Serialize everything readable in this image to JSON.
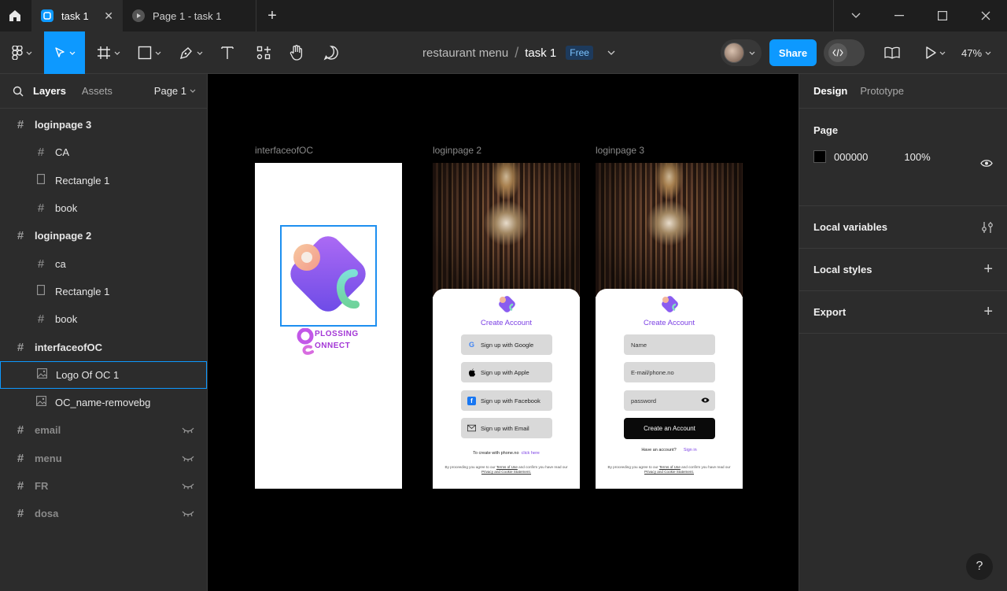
{
  "titlebar": {
    "tabs": [
      {
        "label": "task 1",
        "close": "✕"
      },
      {
        "label": "Page 1 - task 1"
      }
    ],
    "new_tab": "+"
  },
  "toolbar": {
    "project": "restaurant menu",
    "separator": "/",
    "file": "task 1",
    "plan_badge": "Free",
    "share_label": "Share",
    "zoom": "47%"
  },
  "left_panel": {
    "tabs": {
      "layers": "Layers",
      "assets": "Assets"
    },
    "page_selector": "Page 1",
    "layers": [
      {
        "name": "loginpage 3",
        "kind": "frame",
        "level": 0
      },
      {
        "name": "CA",
        "kind": "frame",
        "level": 1
      },
      {
        "name": "Rectangle 1",
        "kind": "rect",
        "level": 1
      },
      {
        "name": "book",
        "kind": "frame",
        "level": 1
      },
      {
        "name": "loginpage 2",
        "kind": "frame",
        "level": 0
      },
      {
        "name": "ca",
        "kind": "frame",
        "level": 1
      },
      {
        "name": "Rectangle 1",
        "kind": "rect",
        "level": 1
      },
      {
        "name": "book",
        "kind": "frame",
        "level": 1
      },
      {
        "name": "interfaceofOC",
        "kind": "frame",
        "level": 0
      },
      {
        "name": "Logo Of OC 1",
        "kind": "image",
        "level": 1,
        "selected": true
      },
      {
        "name": "OC_name-removebg",
        "kind": "image",
        "level": 1
      },
      {
        "name": "email",
        "kind": "frame",
        "level": 0,
        "hidden": true
      },
      {
        "name": "menu",
        "kind": "frame",
        "level": 0,
        "hidden": true
      },
      {
        "name": "FR",
        "kind": "frame",
        "level": 0,
        "hidden": true
      },
      {
        "name": "dosa",
        "kind": "frame",
        "level": 0,
        "hidden": true
      }
    ]
  },
  "canvas": {
    "frames": {
      "interface": {
        "label": "interfaceofOC",
        "brand_line1": "PLOSSING",
        "brand_line2": "ONNECT"
      },
      "login2": {
        "label": "loginpage 2",
        "title": "Create Account",
        "buttons": [
          "Sign up with Google",
          "Sign up with Apple",
          "Sign up with Facebook",
          "Sign up with Email"
        ],
        "phone_text": "To create with phone.no",
        "phone_link": "click here",
        "legal_a": "By proceeding you agree to our",
        "legal_terms": "Terms of Use",
        "legal_b": "and confirm you have read our",
        "legal_privacy": "Privacy and Cookie Statement."
      },
      "login3": {
        "label": "loginpage 3",
        "title": "Create Account",
        "fields": [
          "Name",
          "E-mail/phone.no",
          "password"
        ],
        "submit": "Create an Account",
        "have_account": "Have an account?",
        "signin": "Sign in",
        "legal_a": "By proceeding you agree to our",
        "legal_terms": "Terms of Use",
        "legal_b": "and confirm you have read our",
        "legal_privacy": "Privacy and Cookie Statement."
      }
    }
  },
  "right_panel": {
    "tabs": {
      "design": "Design",
      "prototype": "Prototype"
    },
    "page_section": "Page",
    "page_color": "000000",
    "page_opacity": "100%",
    "local_variables": "Local variables",
    "local_styles": "Local styles",
    "export": "Export",
    "plus": "+"
  },
  "help": "?",
  "colors": {
    "accent": "#0d99ff",
    "purple": "#7b3fe4",
    "canvas": "#000000"
  }
}
